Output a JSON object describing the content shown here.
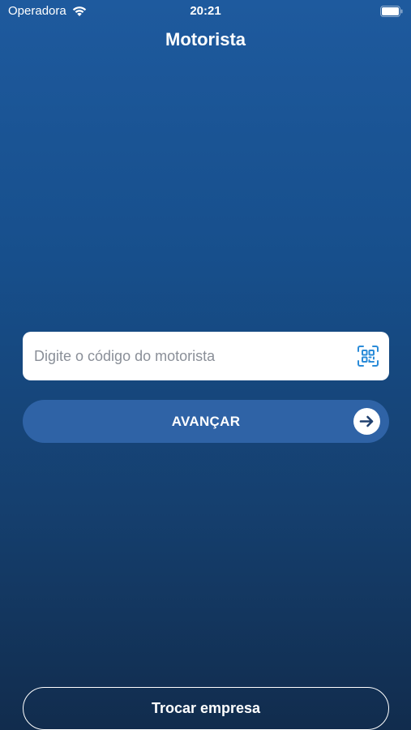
{
  "status_bar": {
    "carrier": "Operadora",
    "time": "20:21",
    "icons": [
      "wifi-icon",
      "battery-icon"
    ]
  },
  "header": {
    "title": "Motorista"
  },
  "form": {
    "code_placeholder": "Digite o código do motorista",
    "code_value": "",
    "qr_icon": "qr-code-scan-icon",
    "advance_label": "AVANÇAR",
    "advance_icon": "arrow-right-circle-icon"
  },
  "footer": {
    "switch_company_label": "Trocar empresa"
  },
  "colors": {
    "gradient_top": "#1e5a9e",
    "gradient_bottom": "#112c4d",
    "button_fill": "#2f63a6",
    "accent_blue": "#2a8bd8"
  }
}
